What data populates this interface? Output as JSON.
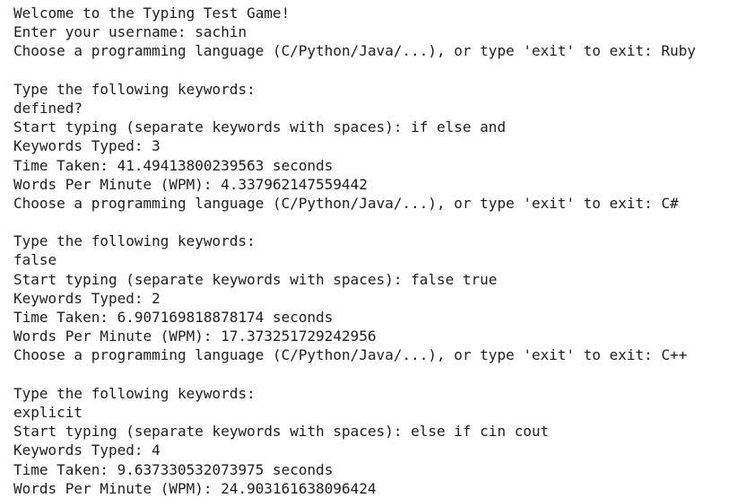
{
  "console": {
    "lines": [
      "Welcome to the Typing Test Game!",
      "Enter your username: sachin",
      "Choose a programming language (C/Python/Java/...), or type 'exit' to exit: Ruby",
      "",
      "Type the following keywords:",
      "defined?",
      "Start typing (separate keywords with spaces): if else and",
      "Keywords Typed: 3",
      "Time Taken: 41.49413800239563 seconds",
      "Words Per Minute (WPM): 4.337962147559442",
      "Choose a programming language (C/Python/Java/...), or type 'exit' to exit: C#",
      "",
      "Type the following keywords:",
      "false",
      "Start typing (separate keywords with spaces): false true",
      "Keywords Typed: 2",
      "Time Taken: 6.907169818878174 seconds",
      "Words Per Minute (WPM): 17.373251729242956",
      "Choose a programming language (C/Python/Java/...), or type 'exit' to exit: C++",
      "",
      "Type the following keywords:",
      "explicit",
      "Start typing (separate keywords with spaces): else if cin cout",
      "Keywords Typed: 4",
      "Time Taken: 9.637330532073975 seconds",
      "Words Per Minute (WPM): 24.903161638096424"
    ]
  }
}
